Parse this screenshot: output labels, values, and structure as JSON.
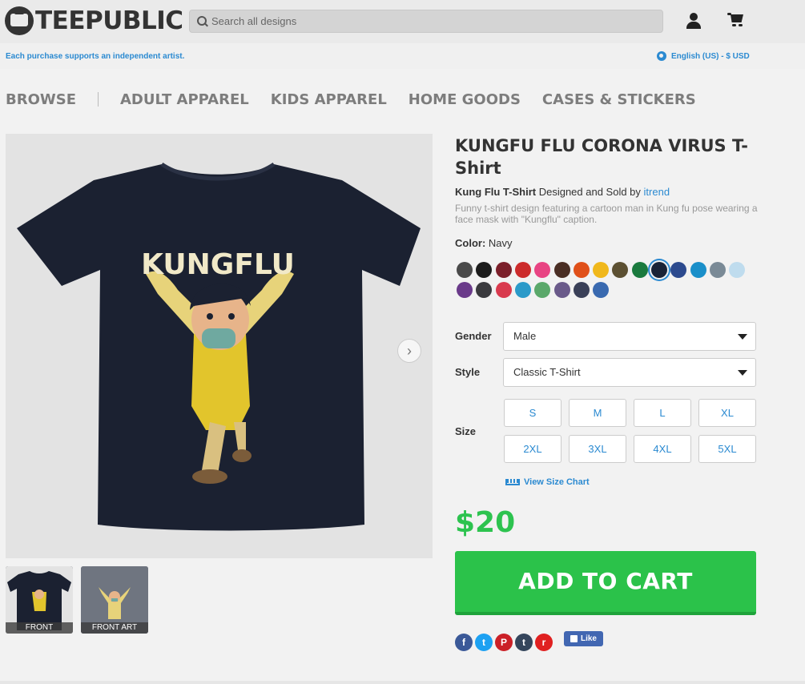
{
  "header": {
    "logo": "TEEPUBLIC",
    "search_placeholder": "Search all designs"
  },
  "subbar": {
    "support_text": "Each purchase supports an independent artist.",
    "language": "English (US) - $ USD"
  },
  "nav": {
    "items": [
      "BROWSE",
      "ADULT APPAREL",
      "KIDS APPAREL",
      "HOME GOODS",
      "CASES & STICKERS"
    ]
  },
  "product": {
    "title": "KUNGFU FLU CORONA VIRUS T-Shirt",
    "design_name": "Kung Flu T-Shirt",
    "designed_by": " Designed and Sold by ",
    "artist": "itrend",
    "description": "Funny t-shirt design featuring a cartoon man in Kung fu pose wearing a face mask with \"Kungflu\" caption.",
    "image_text": "KUNGFLU",
    "thumbnails": [
      {
        "label": "FRONT"
      },
      {
        "label": "FRONT ART"
      }
    ]
  },
  "color": {
    "label": "Color:",
    "selected": "Navy",
    "swatches": [
      "#4a4a4a",
      "#1c1c1c",
      "#7b1f2a",
      "#cc2b2b",
      "#e84483",
      "#4a2e24",
      "#e0501a",
      "#f0b81c",
      "#5c5032",
      "#1a7a3e",
      "#1a2438",
      "#2c4a8e",
      "#1a8fc9",
      "#7a8a96",
      "#bfdcee",
      "#6a3a8a",
      "#3a3a3e",
      "#d93a4e",
      "#2b9ac9",
      "#5aa86a",
      "#6a5a8a",
      "#3a4058",
      "#3a6ab0"
    ],
    "selected_index": 10
  },
  "options": {
    "gender_label": "Gender",
    "gender_value": "Male",
    "style_label": "Style",
    "style_value": "Classic T-Shirt",
    "size_label": "Size",
    "sizes": [
      "S",
      "M",
      "L",
      "XL",
      "2XL",
      "3XL",
      "4XL",
      "5XL"
    ],
    "size_chart": "View Size Chart"
  },
  "purchase": {
    "price": "$20",
    "add_to_cart": "ADD TO CART",
    "like": "Like"
  },
  "share": [
    {
      "icon": "facebook-icon",
      "glyph": "f",
      "color": "#3b5998"
    },
    {
      "icon": "twitter-icon",
      "glyph": "t",
      "color": "#1da1f2"
    },
    {
      "icon": "pinterest-icon",
      "glyph": "P",
      "color": "#cb2027"
    },
    {
      "icon": "tumblr-icon",
      "glyph": "t",
      "color": "#35465c"
    },
    {
      "icon": "reddit-icon",
      "glyph": "r",
      "color": "#e02020"
    }
  ]
}
